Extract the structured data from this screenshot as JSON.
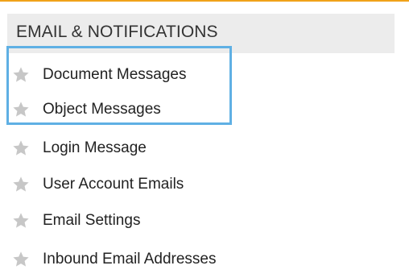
{
  "section": {
    "title": "EMAIL & NOTIFICATIONS"
  },
  "menu": {
    "items": [
      {
        "label": "Document Messages",
        "icon": "star-icon",
        "highlighted": true
      },
      {
        "label": "Object Messages",
        "icon": "star-icon",
        "highlighted": true
      },
      {
        "label": "Login Message",
        "icon": "star-icon",
        "highlighted": false
      },
      {
        "label": "User Account Emails",
        "icon": "star-icon",
        "highlighted": false
      },
      {
        "label": "Email Settings",
        "icon": "star-icon",
        "highlighted": false
      },
      {
        "label": "Inbound Email Addresses",
        "icon": "star-icon",
        "highlighted": false
      }
    ]
  },
  "colors": {
    "accent_top": "#f0a21a",
    "highlight": "#5fb0e4",
    "star": "#c7c7c7",
    "header_bg": "#ececec"
  }
}
